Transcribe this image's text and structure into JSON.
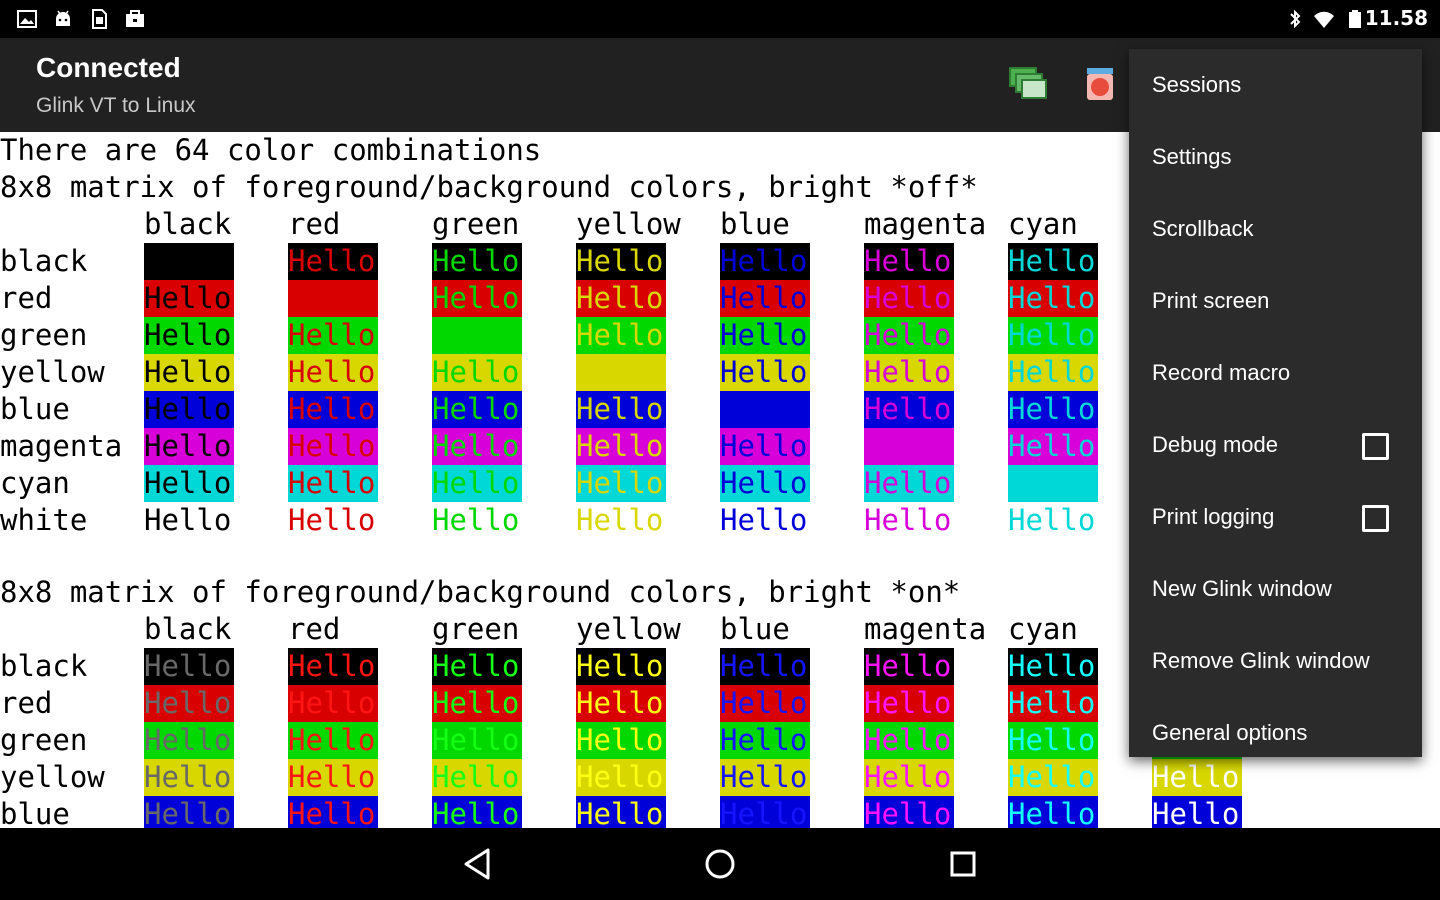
{
  "status_bar": {
    "left_icons": [
      "gallery-icon",
      "android-icon",
      "sim-card-icon",
      "briefcase-icon"
    ],
    "right_icons": [
      "bluetooth-icon",
      "wifi-icon",
      "battery-icon"
    ],
    "time": "11.58"
  },
  "action_bar": {
    "title": "Connected",
    "subtitle": "Glink VT to Linux",
    "buttons": [
      "sessions-icon",
      "record-icon"
    ]
  },
  "colors": {
    "black": "#000000",
    "red": "#d80000",
    "green": "#00d800",
    "yellow": "#d8d800",
    "blue": "#0000d8",
    "magenta": "#d800d8",
    "cyan": "#00d8d8",
    "white": "#d8d8d8",
    "bright_black": "#686868",
    "bright_red": "#ff1414",
    "bright_green": "#14ff14",
    "bright_yellow": "#ffff14",
    "bright_blue": "#1414ff",
    "bright_magenta": "#ff14ff",
    "bright_cyan": "#14ffff",
    "bright_white": "#ffffff"
  },
  "terminal": {
    "header_text": "There are 64 color combinations",
    "cell_text": "Hello",
    "col_names": [
      "black",
      "red",
      "green",
      "yellow",
      "blue",
      "magenta",
      "cyan"
    ],
    "row_names_off": [
      "black",
      "red",
      "green",
      "yellow",
      "blue",
      "magenta",
      "cyan",
      "white"
    ],
    "row_names_on": [
      "black",
      "red",
      "green",
      "yellow",
      "blue"
    ],
    "matrix_off_title": "8x8 matrix of foreground/background colors, bright *off*",
    "matrix_on_title": "8x8 matrix of foreground/background colors, bright *on*"
  },
  "menu": {
    "items": [
      {
        "label": "Sessions"
      },
      {
        "label": "Settings"
      },
      {
        "label": "Scrollback"
      },
      {
        "label": "Print screen"
      },
      {
        "label": "Record macro"
      },
      {
        "label": "Debug mode",
        "checkbox": true,
        "checked": false
      },
      {
        "label": "Print logging",
        "checkbox": true,
        "checked": false
      },
      {
        "label": "New Glink window"
      },
      {
        "label": "Remove Glink window"
      },
      {
        "label": "General options"
      }
    ]
  },
  "nav_bar": {
    "buttons": [
      "back-icon",
      "home-icon",
      "recents-icon"
    ]
  }
}
